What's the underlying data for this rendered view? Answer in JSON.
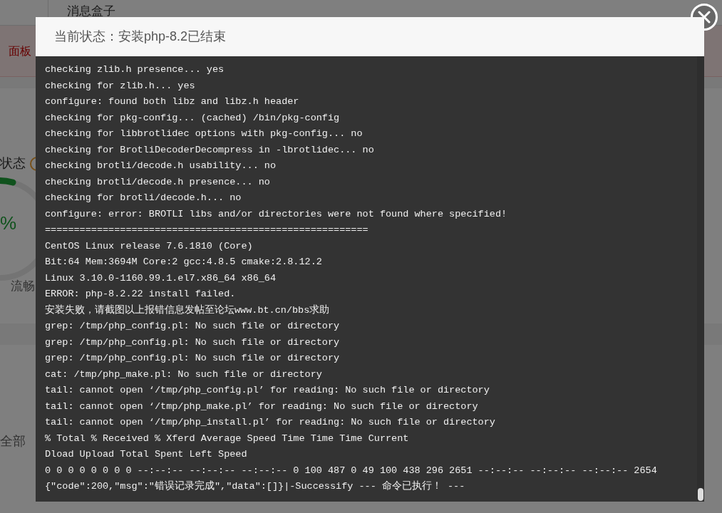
{
  "background": {
    "message_box": "消息盒子",
    "alert": "面板",
    "status_title": "状态",
    "gauge_value": "%",
    "gauge_caption": "流畅",
    "filter": "全部"
  },
  "dialog": {
    "title": "当前状态：安装php-8.2已结束",
    "log_lines": [
      "checking zlib.h presence... yes",
      "checking for zlib.h... yes",
      "configure: found both libz and libz.h header",
      "checking for pkg-config... (cached) /bin/pkg-config",
      "checking for libbrotlidec options with pkg-config... no",
      "checking for BrotliDecoderDecompress in -lbrotlidec... no",
      "checking brotli/decode.h usability... no",
      "checking brotli/decode.h presence... no",
      "checking for brotli/decode.h... no",
      "configure: error: BROTLI libs and/or directories were not found where specified!",
      "========================================================",
      "CentOS Linux release 7.6.1810 (Core)",
      "Bit:64 Mem:3694M Core:2 gcc:4.8.5 cmake:2.8.12.2",
      "Linux 3.10.0-1160.99.1.el7.x86_64 x86_64",
      "ERROR: php-8.2.22 install failed.",
      "安装失败，请截图以上报错信息发帖至论坛www.bt.cn/bbs求助",
      "grep: /tmp/php_config.pl: No such file or directory",
      "grep: /tmp/php_config.pl: No such file or directory",
      "grep: /tmp/php_config.pl: No such file or directory",
      "cat: /tmp/php_make.pl: No such file or directory",
      "tail: cannot open ‘/tmp/php_config.pl’ for reading: No such file or directory",
      "tail: cannot open ‘/tmp/php_make.pl’ for reading: No such file or directory",
      "tail: cannot open ‘/tmp/php_install.pl’ for reading: No such file or directory",
      "% Total % Received % Xferd Average Speed Time Time Time Current",
      "Dload Upload Total Spent Left Speed",
      "0 0 0 0 0 0 0 0 --:--:-- --:--:-- --:--:-- 0 100 487 0 49 100 438 296 2651 --:--:-- --:--:-- --:--:-- 2654",
      "{\"code\":200,\"msg\":\"错误记录完成\",\"data\":[]}|-Successify --- 命令已执行！ ---"
    ]
  }
}
